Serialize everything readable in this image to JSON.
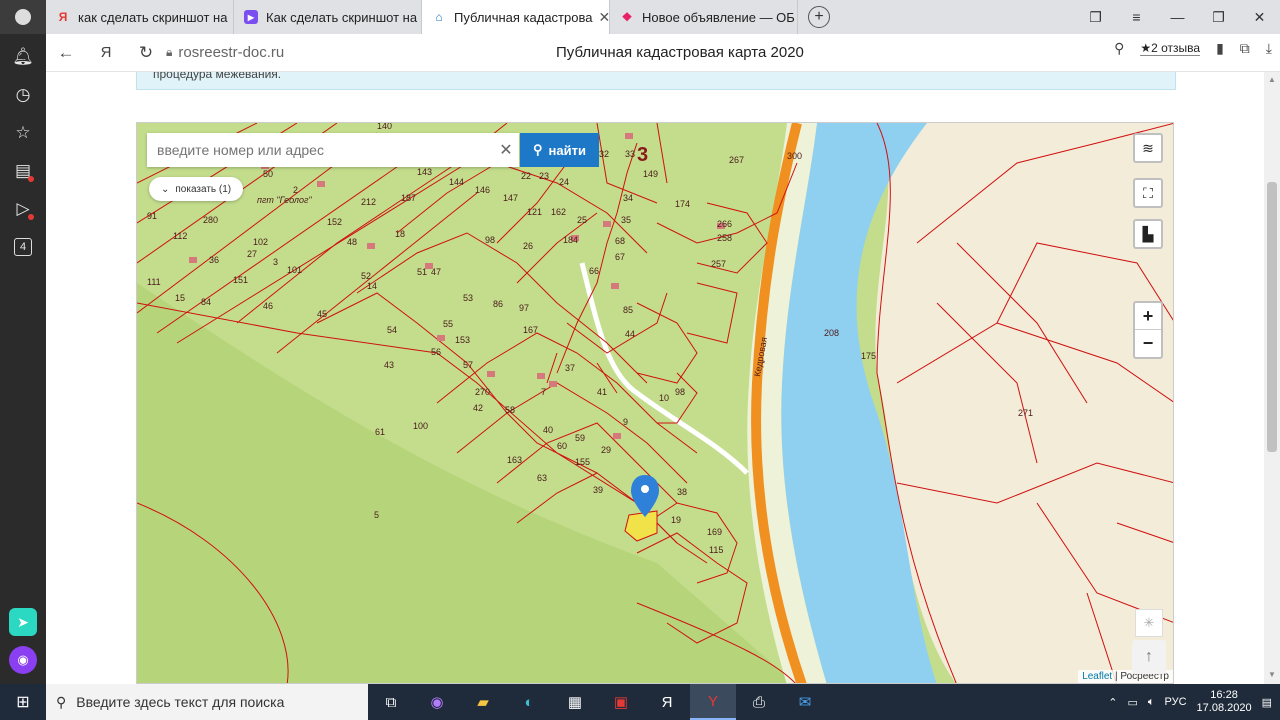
{
  "browser": {
    "tabs": [
      {
        "label": "как сделать скриншот на",
        "icon": "yandex-icon"
      },
      {
        "label": "Как сделать скриншот на",
        "icon": "video-icon"
      },
      {
        "label": "Публичная кадастрова",
        "icon": "home-icon",
        "active": true
      },
      {
        "label": "Новое объявление — ОБ",
        "icon": "grid-icon"
      }
    ],
    "domain": "rosreestr-doc.ru",
    "page_title": "Публичная кадастровая карта 2020",
    "reviews": "★2 отзыва"
  },
  "sidebar": {
    "counter": "4"
  },
  "page": {
    "info_text": "процедура межевания.",
    "search_placeholder": "введите номер или адрес",
    "search_button": "найти",
    "show_button": "показать (1)",
    "zoom_in": "+",
    "zoom_out": "−",
    "attribution_leaflet": "Leaflet",
    "attribution_rest": " | Росреестр"
  },
  "map": {
    "street_label": "Кедровая",
    "village_label": "пгт \"Геолог\"",
    "cluster_number": "3",
    "parcels": [
      "140",
      "143",
      "32",
      "33",
      "149",
      "267",
      "300",
      "50",
      "2",
      "187",
      "144",
      "146",
      "147",
      "22",
      "23",
      "24",
      "34",
      "212",
      "162",
      "121",
      "25",
      "35",
      "174",
      "266",
      "258",
      "152",
      "18",
      "98",
      "26",
      "184",
      "68",
      "67",
      "257",
      "91",
      "112",
      "280",
      "102",
      "48",
      "51",
      "52",
      "47",
      "66",
      "53",
      "97",
      "27",
      "36",
      "3",
      "151",
      "101",
      "111",
      "15",
      "84",
      "46",
      "45",
      "54",
      "55",
      "86",
      "167",
      "85",
      "14",
      "153",
      "44",
      "43",
      "56",
      "57",
      "37",
      "270",
      "100",
      "42",
      "7",
      "41",
      "58",
      "40",
      "59",
      "98",
      "163",
      "60",
      "9",
      "29",
      "10",
      "65",
      "61",
      "63",
      "155",
      "39",
      "38",
      "19",
      "169",
      "115",
      "5",
      "271",
      "208",
      "175"
    ],
    "colors": {
      "grass": "#c3dd8c",
      "river": "#8fd0f0",
      "bank": "#f3ecd9",
      "road": "#f09020",
      "border": "#d01010",
      "marker": "#2f80d8",
      "selected": "#f2e24a"
    }
  },
  "taskbar": {
    "search_placeholder": "Введите здесь текст для поиска",
    "lang": "РУС",
    "time": "16:28",
    "date": "17.08.2020"
  }
}
